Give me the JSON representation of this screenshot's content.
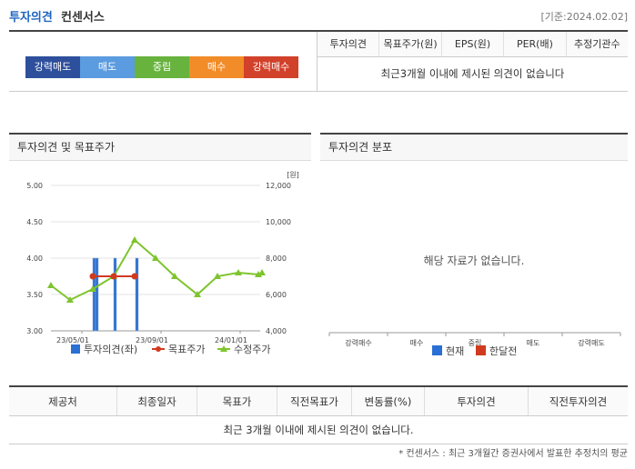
{
  "header": {
    "title": "투자의견",
    "subtitle": "컨센서스",
    "date": "[기준:2024.02.02]"
  },
  "colors": {
    "accent": "#2166c2",
    "opinion_bar": "#2a6fd3",
    "target_price": "#d03a1f",
    "adjusted_price": "#7ec42e"
  },
  "opinion_scale": [
    {
      "label": "강력매도",
      "color": "#2e4f9c"
    },
    {
      "label": "매도",
      "color": "#5b9be0"
    },
    {
      "label": "중립",
      "color": "#67b33e"
    },
    {
      "label": "매수",
      "color": "#f28c28"
    },
    {
      "label": "강력매수",
      "color": "#d2412a"
    }
  ],
  "summary_table": {
    "headers": [
      "투자의견",
      "목표주가(원)",
      "EPS(원)",
      "PER(배)",
      "추정기관수"
    ],
    "empty_message": "최근3개월 이내에 제시된 의견이 없습니다"
  },
  "left_panel": {
    "title": "투자의견 및 목표주가"
  },
  "right_panel": {
    "title": "투자의견 분포",
    "empty_message": "해당 자료가 없습니다."
  },
  "chart_data": [
    {
      "type": "line",
      "y2_unit": "[원]",
      "y_left": {
        "ylim": [
          3.0,
          5.0
        ],
        "ticks": [
          "5.00",
          "4.50",
          "4.00",
          "3.50",
          "3.00"
        ]
      },
      "y_right": {
        "ylim": [
          4000,
          12000
        ],
        "ticks": [
          "12,000",
          "10,000",
          "8,000",
          "6,000",
          "4,000"
        ]
      },
      "x_ticks": [
        "23/05/01",
        "23/09/01",
        "24/01/01"
      ],
      "series": [
        {
          "name": "투자의견(좌)",
          "type": "bar",
          "values": [
            4.0,
            4.0,
            4.0,
            4.0
          ]
        },
        {
          "name": "목표주가",
          "type": "line",
          "values": [
            7000,
            7000,
            7000
          ]
        },
        {
          "name": "수정주가",
          "type": "line",
          "values": [
            6500,
            5700,
            6300,
            7000,
            9000,
            8000,
            7000,
            6000,
            7000,
            7200,
            7100,
            7200
          ]
        }
      ],
      "legend": [
        "투자의견(좌)",
        "목표주가",
        "수정주가"
      ]
    },
    {
      "type": "bar",
      "categories": [
        "강력매수",
        "매수",
        "중립",
        "매도",
        "강력매도"
      ],
      "series": [
        {
          "name": "현재",
          "color": "#2a6fd3",
          "values": []
        },
        {
          "name": "한달전",
          "color": "#d03a1f",
          "values": []
        }
      ],
      "legend": [
        "현재",
        "한달전"
      ]
    }
  ],
  "history_table": {
    "headers": [
      "제공처",
      "최종일자",
      "목표가",
      "직전목표가",
      "변동률(%)",
      "투자의견",
      "직전투자의견"
    ],
    "empty_message": "최근 3개월 이내에 제시된 의견이 없습니다."
  },
  "footnote": "* 컨센서스 : 최근 3개월간 증권사에서 발표한 추정치의 평균"
}
